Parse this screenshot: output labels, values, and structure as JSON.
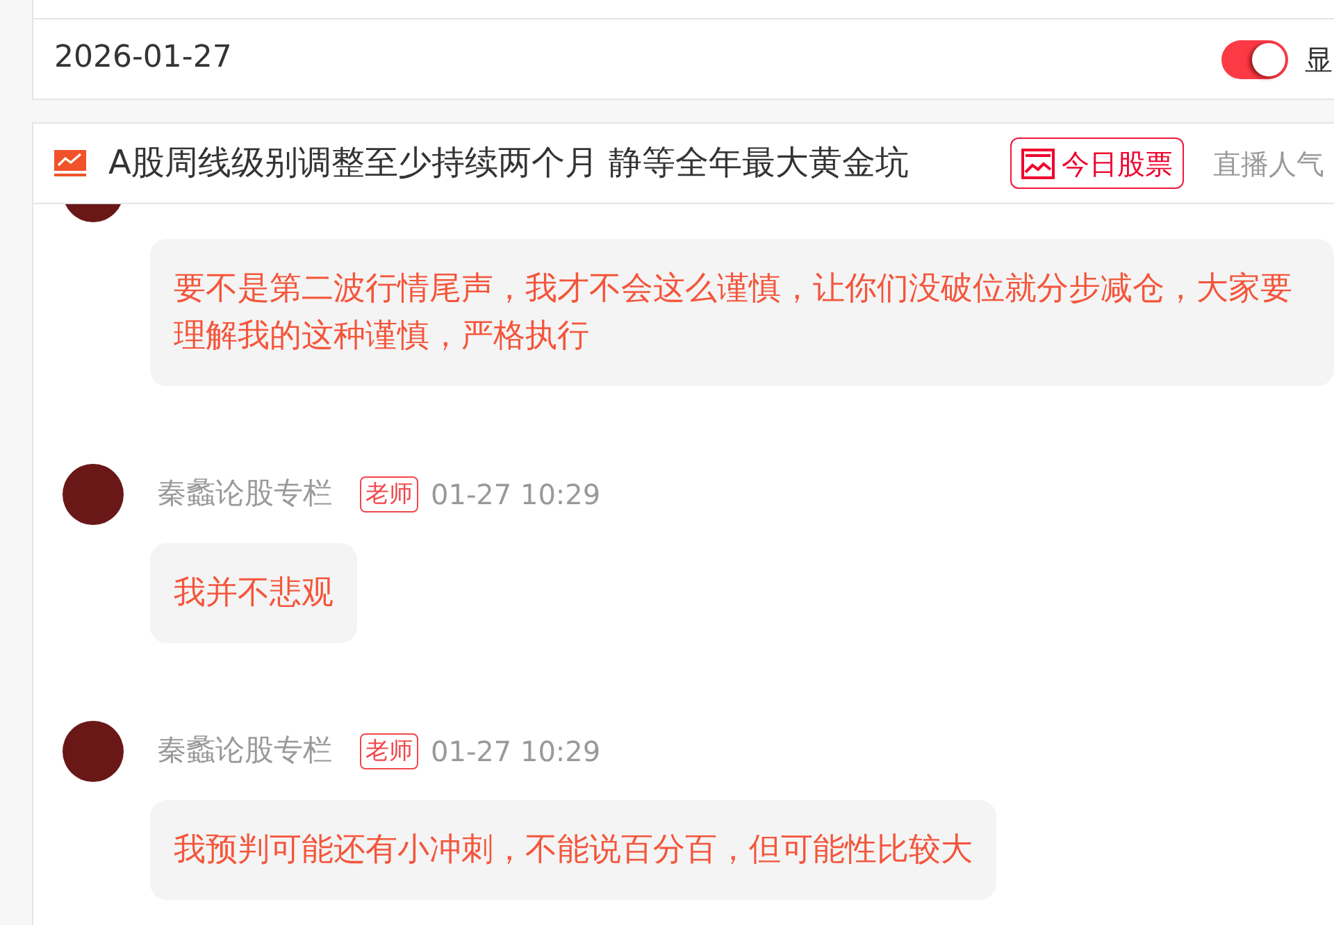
{
  "top_bar": {
    "date": "2026-01-27",
    "toggle": {
      "on": true
    },
    "toggle_label": "显"
  },
  "live_header": {
    "title": "A股周线级别调整至少持续两个月 静等全年最大黄金坑",
    "stock_button": "今日股票",
    "popularity_label": "直播人气"
  },
  "messages": [
    {
      "text": "要不是第二波行情尾声，我才不会这么谨慎，让你们没破位就分步减仓，大家要理解我的这种谨慎，严格执行"
    },
    {
      "author": "秦蠡论股专栏",
      "role_tag": "老师",
      "time": "01-27 10:29",
      "text": "我并不悲观"
    },
    {
      "author": "秦蠡论股专栏",
      "role_tag": "老师",
      "time": "01-27 10:29",
      "text": "我预判可能还有小冲刺，不能说百分百，但可能性比较大"
    }
  ]
}
